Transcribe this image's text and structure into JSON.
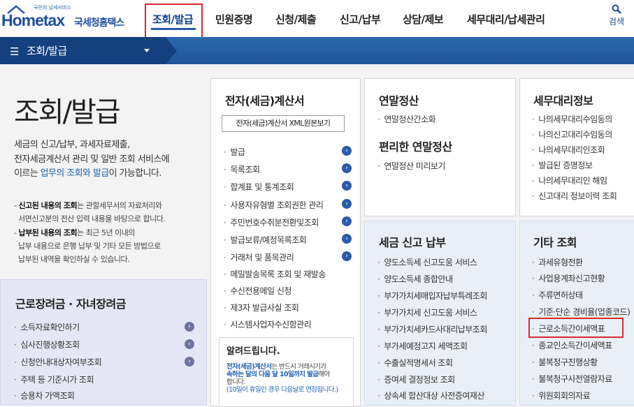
{
  "header": {
    "logo_tag": "국민의 납세서비스",
    "logo_word": "Hometax",
    "logo_kr": "국세청홈택스",
    "nav": [
      "조회/발급",
      "민원증명",
      "신청/제출",
      "신고/납부",
      "상담/제보",
      "세무대리/납세관리"
    ],
    "search_label": "검색"
  },
  "subnav": {
    "title": "조회/발급"
  },
  "page": {
    "title": "조회/발급",
    "intro_l1": "세금의 신고/납부, 과세자료제출,",
    "intro_l2": "전자세금계산서 관리 및 일반 조회 서비스에",
    "intro_l3a": "이르는 ",
    "intro_l3b": "업무의 조회와 발급",
    "intro_l3c": "이 가능합니다.",
    "note1_a": "- ",
    "note1_b": "신고된 내용의 조회",
    "note1_c": "는 관할세무서의 자료처리와",
    "note1_l2": "  서면신고분의 전산 입력 내용을 바탕으로 합니다.",
    "note2_a": "- ",
    "note2_b": "납부된 내용의 조회",
    "note2_c": "는 최근 5년 이내의",
    "note2_l2": "  납부 내용으로 은행 납부 및 기타 모든 방법으로",
    "note2_l3": "  납부된 내역을 확인하실 수 있습니다."
  },
  "card_labor": {
    "title": "근로장려금 · 자녀장려금",
    "items": [
      "소득자료확인하기",
      "심사진행상황조회",
      "신청안내대상자여부조회",
      "주택 등 기준시가 조회",
      "승용차 가액조회"
    ]
  },
  "card_invoice": {
    "title": "전자(세금)계산서",
    "button": "전자(세금)계산서 XML원본보기",
    "items": [
      "발급",
      "목록조회",
      "합계표 및 통계조회",
      "사용자유형별 조회권한 관리",
      "주민번호수취분전환및조회",
      "발급보류/예정목록조회",
      "거래처 및 품목관리",
      "메일발송목록 조회 및 재발송",
      "수신전용메일 신청",
      "제3자 발급사실 조회",
      "시스템사업자수신함관리"
    ],
    "notice_title": "알려드립니다.",
    "notice_l1a": "전자(세금)계산서",
    "notice_l1b": "는 반드시 거래시기가",
    "notice_l2a": "속하는 달의 다음 달 10일까지 발급",
    "notice_l2b": "해야",
    "notice_l3": "합니다.",
    "notice_l4": "(10일이 휴일인 경우 다음날로 연장됩니다.)"
  },
  "card_yearend": {
    "title": "연말정산",
    "items": [
      "연말정산간소화"
    ],
    "title2": "편리한 연말정산",
    "items2": [
      "연말정산 미리보기"
    ]
  },
  "card_tax": {
    "title": "세금 신고 납부",
    "items": [
      "양도소득세 신고도움 서비스",
      "양도소득세 종합안내",
      "부가가치세매입자납부특례조회",
      "부가가치세 신고도움 서비스",
      "부가가치세카드사대리납부조회",
      "부가세예정고지 세액조회",
      "수출실적명세서 조회",
      "증여세 결정정보 조회",
      "상속세 합산대상 사전증여재산"
    ]
  },
  "card_agent": {
    "title": "세무대리정보",
    "items": [
      "나의세무대리수임동의",
      "나의신고대리수임동의",
      "나의세무대리인조회",
      "발급된 증명정보",
      "나의세무대리인 해임",
      "신고대리 정보이력 조회"
    ]
  },
  "card_other": {
    "title": "기타 조회",
    "items": [
      "과세유형전환",
      "사업용계좌신고현황",
      "주류면허상태",
      "기준·단순 경비율(업종코드)",
      "근로소득간이세액표",
      "종교인소득간이세액표",
      "불복청구진행상황",
      "불복청구사전열람자료",
      "위원회회의자료"
    ]
  },
  "colors": {
    "brand": "#1e4fa0",
    "subnav": "#2c68ad",
    "highlight": "#d8282f",
    "link": "#1e62b6"
  }
}
